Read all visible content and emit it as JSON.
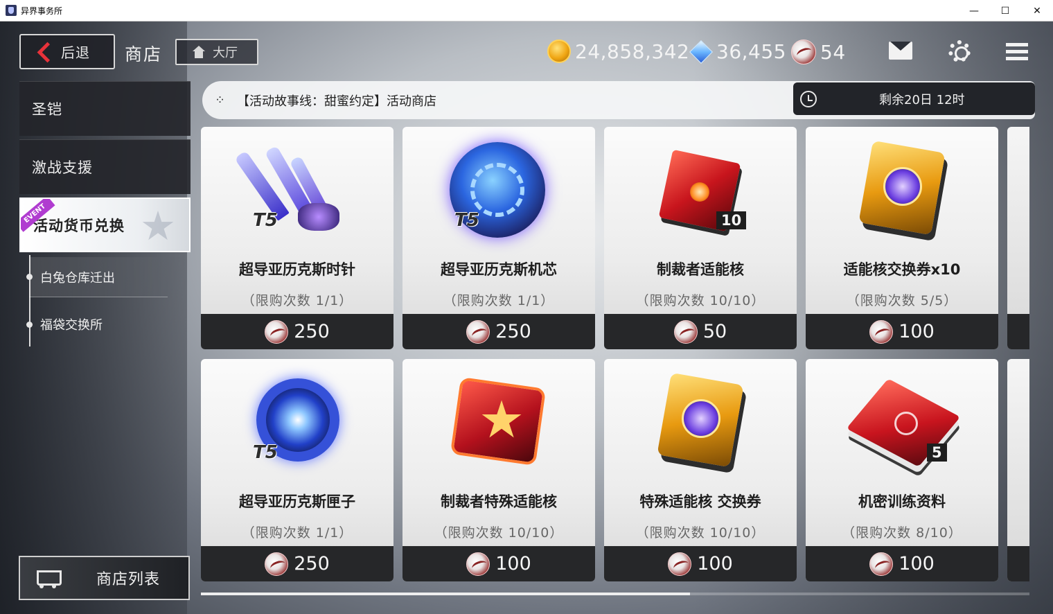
{
  "window": {
    "title": "异界事务所",
    "minimize": "—",
    "maximize": "☐",
    "close": "✕"
  },
  "header": {
    "back_label": "后退",
    "page_title": "商店",
    "hall_label": "大厅",
    "currencies": [
      {
        "icon": "gold-coin-icon",
        "value": "24,858,342"
      },
      {
        "icon": "diamond-gem-icon",
        "value": "36,455"
      },
      {
        "icon": "event-token-icon",
        "value": "54"
      }
    ],
    "icons": [
      "mail-icon",
      "gear-icon",
      "menu-icon"
    ]
  },
  "sidebar": {
    "items": [
      {
        "label": "圣铠"
      },
      {
        "label": "激战支援"
      },
      {
        "label": "活动货币兑换",
        "badge": "EVENT",
        "active": true
      }
    ],
    "sub_items": [
      {
        "label": "白兔仓库迁出",
        "current": true
      },
      {
        "label": "福袋交换所"
      }
    ],
    "shop_list_label": "商店列表"
  },
  "banner": {
    "text": "【活动故事线：甜蜜约定】活动商店",
    "timer": "剩余20日 12时"
  },
  "items": [
    {
      "name": "超导亚历克斯时针",
      "limit": "（限购次数  1/1）",
      "price": "250",
      "tier": "T5",
      "art": "blue-claw"
    },
    {
      "name": "超导亚历克斯机芯",
      "limit": "（限购次数  1/1）",
      "price": "250",
      "tier": "T5",
      "art": "blue-gear-orb"
    },
    {
      "name": "制裁者适能核",
      "limit": "（限购次数  10/10）",
      "price": "50",
      "qty": "10",
      "art": "red-cube"
    },
    {
      "name": "适能核交换券x10",
      "limit": "（限购次数  5/5）",
      "price": "100",
      "art": "gold-card"
    },
    {
      "name": "超导亚历克斯匣子",
      "limit": "（限购次数  1/1）",
      "price": "250",
      "tier": "T5",
      "art": "blue-ring"
    },
    {
      "name": "制裁者特殊适能核",
      "limit": "（限购次数  10/10）",
      "price": "100",
      "art": "red-star"
    },
    {
      "name": "特殊适能核  交换券",
      "limit": "（限购次数  10/10）",
      "price": "100",
      "art": "gold-card"
    },
    {
      "name": "机密训练资料",
      "limit": "（限购次数  8/10）",
      "price": "100",
      "qty": "5",
      "art": "red-book"
    }
  ]
}
